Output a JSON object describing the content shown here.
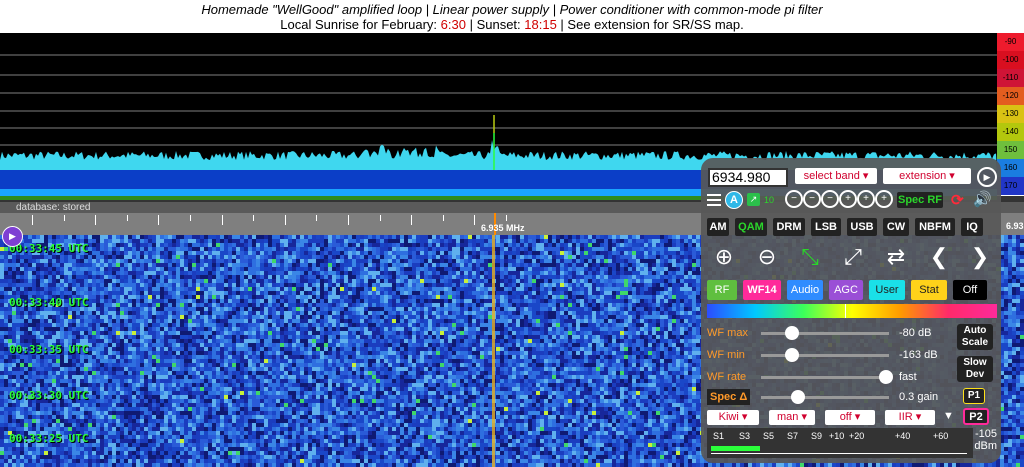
{
  "header": {
    "line1": "Homemade \"WellGood\" amplified loop | Linear power supply | Power conditioner with common-mode pi filter",
    "line2_prefix": "Local Sunrise for February: ",
    "sunrise": "6:30",
    "sep": " | Sunset: ",
    "sunset": "18:15",
    "line2_suffix": " | See extension for SR/SS map."
  },
  "spectrum": {
    "scale_labels": [
      "-90",
      "-100",
      "-110",
      "-120",
      "-130",
      "-140",
      "150",
      "160",
      "170"
    ],
    "scale_colors": [
      "#ee1b2d",
      "#d90f20",
      "#cf1436",
      "#e35d1f",
      "#d9c214",
      "#b3c70d",
      "#6fbf3d",
      "#1a7de0",
      "#2136c7"
    ]
  },
  "status": {
    "database": "database: stored"
  },
  "freq_scale": {
    "center_label": "6.935 MHz",
    "right_label": "6.93"
  },
  "waterfall": {
    "timestamps": [
      "00:33:45 UTC",
      "00:33:40 UTC",
      "00:33:35 UTC",
      "00:33:30 UTC",
      "00:33:25 UTC"
    ]
  },
  "panel": {
    "frequency": "6934.980",
    "select_band": "select band",
    "extension": "extension",
    "badge_a": "A",
    "step_label": "10",
    "spec_rf": "Spec RF",
    "modes": [
      "AM",
      "QAM",
      "DRM",
      "LSB",
      "USB",
      "CW",
      "NBFM",
      "IQ"
    ],
    "selected_mode": "QAM",
    "color_buttons": [
      {
        "label": "RF",
        "bg": "#5fbf3f",
        "fg": "#ffffff"
      },
      {
        "label": "WF14",
        "bg": "#ff2a9a",
        "fg": "#ffffff"
      },
      {
        "label": "Audio",
        "bg": "#2f8cff",
        "fg": "#ffffff"
      },
      {
        "label": "AGC",
        "bg": "#9a4fd6",
        "fg": "#ffffff"
      },
      {
        "label": "User",
        "bg": "#1ae0e8",
        "fg": "#222222"
      },
      {
        "label": "Stat",
        "bg": "#ffd21a",
        "fg": "#222222"
      },
      {
        "label": "Off",
        "bg": "#000000",
        "fg": "#ffffff"
      }
    ],
    "sliders": [
      {
        "label": "WF max",
        "value": "-80 dB",
        "pos": 0.2
      },
      {
        "label": "WF min",
        "value": "-163 dB",
        "pos": 0.2
      },
      {
        "label": "WF rate",
        "value": "fast",
        "pos": 1.0
      },
      {
        "label": "Spec Δ",
        "value": "0.3 gain",
        "pos": 0.25
      }
    ],
    "auto_scale": "Auto Scale",
    "slow_dev": "Slow Dev",
    "p1": "P1",
    "p2": "P2",
    "dropdowns": [
      "Kiwi",
      "man",
      "off",
      "IIR"
    ],
    "smeter_labels": [
      "S1",
      "S3",
      "S5",
      "S7",
      "S9",
      "+10",
      "+20",
      "+40",
      "+60"
    ],
    "smeter_value": "-105",
    "smeter_unit": "dBm",
    "smeter_level": 0.19
  }
}
